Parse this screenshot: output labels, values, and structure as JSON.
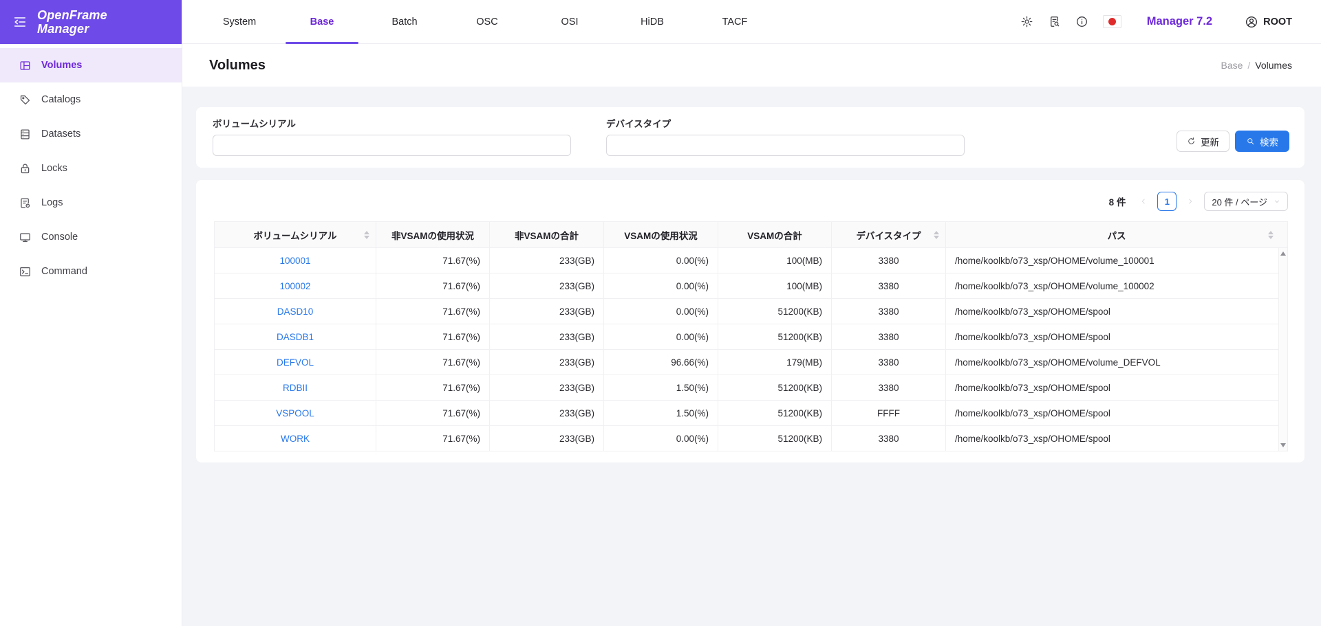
{
  "colors": {
    "brand_purple": "#6E4BE8",
    "active_purple": "#6D28D9",
    "primary_blue": "#2878EA",
    "flag_red": "#DF2B2B",
    "content_bg": "#F3F4F8"
  },
  "brand": {
    "line1": "OpenFrame",
    "line2": "Manager"
  },
  "topnav": {
    "tabs": [
      {
        "label": "System",
        "active": false
      },
      {
        "label": "Base",
        "active": true
      },
      {
        "label": "Batch",
        "active": false
      },
      {
        "label": "OSC",
        "active": false
      },
      {
        "label": "OSI",
        "active": false
      },
      {
        "label": "HiDB",
        "active": false
      },
      {
        "label": "TACF",
        "active": false
      }
    ],
    "icons": [
      "settings-icon",
      "file-search-icon",
      "info-icon",
      "language-flag-japan"
    ],
    "version": "Manager 7.2",
    "user": "ROOT"
  },
  "sidebar": {
    "items": [
      {
        "label": "Volumes",
        "icon": "volumes-icon",
        "active": true
      },
      {
        "label": "Catalogs",
        "icon": "catalogs-icon",
        "active": false
      },
      {
        "label": "Datasets",
        "icon": "datasets-icon",
        "active": false
      },
      {
        "label": "Locks",
        "icon": "locks-icon",
        "active": false
      },
      {
        "label": "Logs",
        "icon": "logs-icon",
        "active": false
      },
      {
        "label": "Console",
        "icon": "console-icon",
        "active": false
      },
      {
        "label": "Command",
        "icon": "command-icon",
        "active": false
      }
    ]
  },
  "page": {
    "title": "Volumes",
    "breadcrumb": [
      "Base",
      "Volumes"
    ],
    "breadcrumb_sep": "/"
  },
  "filters": {
    "fields": [
      {
        "label": "ボリュームシリアル",
        "value": ""
      },
      {
        "label": "デバイスタイプ",
        "value": ""
      }
    ],
    "refresh_label": "更新",
    "search_label": "検索"
  },
  "pagination": {
    "total": "8 件",
    "page": "1",
    "page_size": "20 件 / ページ"
  },
  "table": {
    "columns": [
      {
        "label": "ボリュームシリアル",
        "sortable": true
      },
      {
        "label": "非VSAMの使用状況",
        "sortable": false
      },
      {
        "label": "非VSAMの合計",
        "sortable": false
      },
      {
        "label": "VSAMの使用状況",
        "sortable": false
      },
      {
        "label": "VSAMの合計",
        "sortable": false
      },
      {
        "label": "デバイスタイプ",
        "sortable": true
      },
      {
        "label": "パス",
        "sortable": true
      }
    ],
    "rows": [
      [
        "100001",
        "71.67(%)",
        "233(GB)",
        "0.00(%)",
        "100(MB)",
        "3380",
        "/home/koolkb/o73_xsp/OHOME/volume_100001"
      ],
      [
        "100002",
        "71.67(%)",
        "233(GB)",
        "0.00(%)",
        "100(MB)",
        "3380",
        "/home/koolkb/o73_xsp/OHOME/volume_100002"
      ],
      [
        "DASD10",
        "71.67(%)",
        "233(GB)",
        "0.00(%)",
        "51200(KB)",
        "3380",
        "/home/koolkb/o73_xsp/OHOME/spool"
      ],
      [
        "DASDB1",
        "71.67(%)",
        "233(GB)",
        "0.00(%)",
        "51200(KB)",
        "3380",
        "/home/koolkb/o73_xsp/OHOME/spool"
      ],
      [
        "DEFVOL",
        "71.67(%)",
        "233(GB)",
        "96.66(%)",
        "179(MB)",
        "3380",
        "/home/koolkb/o73_xsp/OHOME/volume_DEFVOL"
      ],
      [
        "RDBII",
        "71.67(%)",
        "233(GB)",
        "1.50(%)",
        "51200(KB)",
        "3380",
        "/home/koolkb/o73_xsp/OHOME/spool"
      ],
      [
        "VSPOOL",
        "71.67(%)",
        "233(GB)",
        "1.50(%)",
        "51200(KB)",
        "FFFF",
        "/home/koolkb/o73_xsp/OHOME/spool"
      ],
      [
        "WORK",
        "71.67(%)",
        "233(GB)",
        "0.00(%)",
        "51200(KB)",
        "3380",
        "/home/koolkb/o73_xsp/OHOME/spool"
      ]
    ]
  }
}
